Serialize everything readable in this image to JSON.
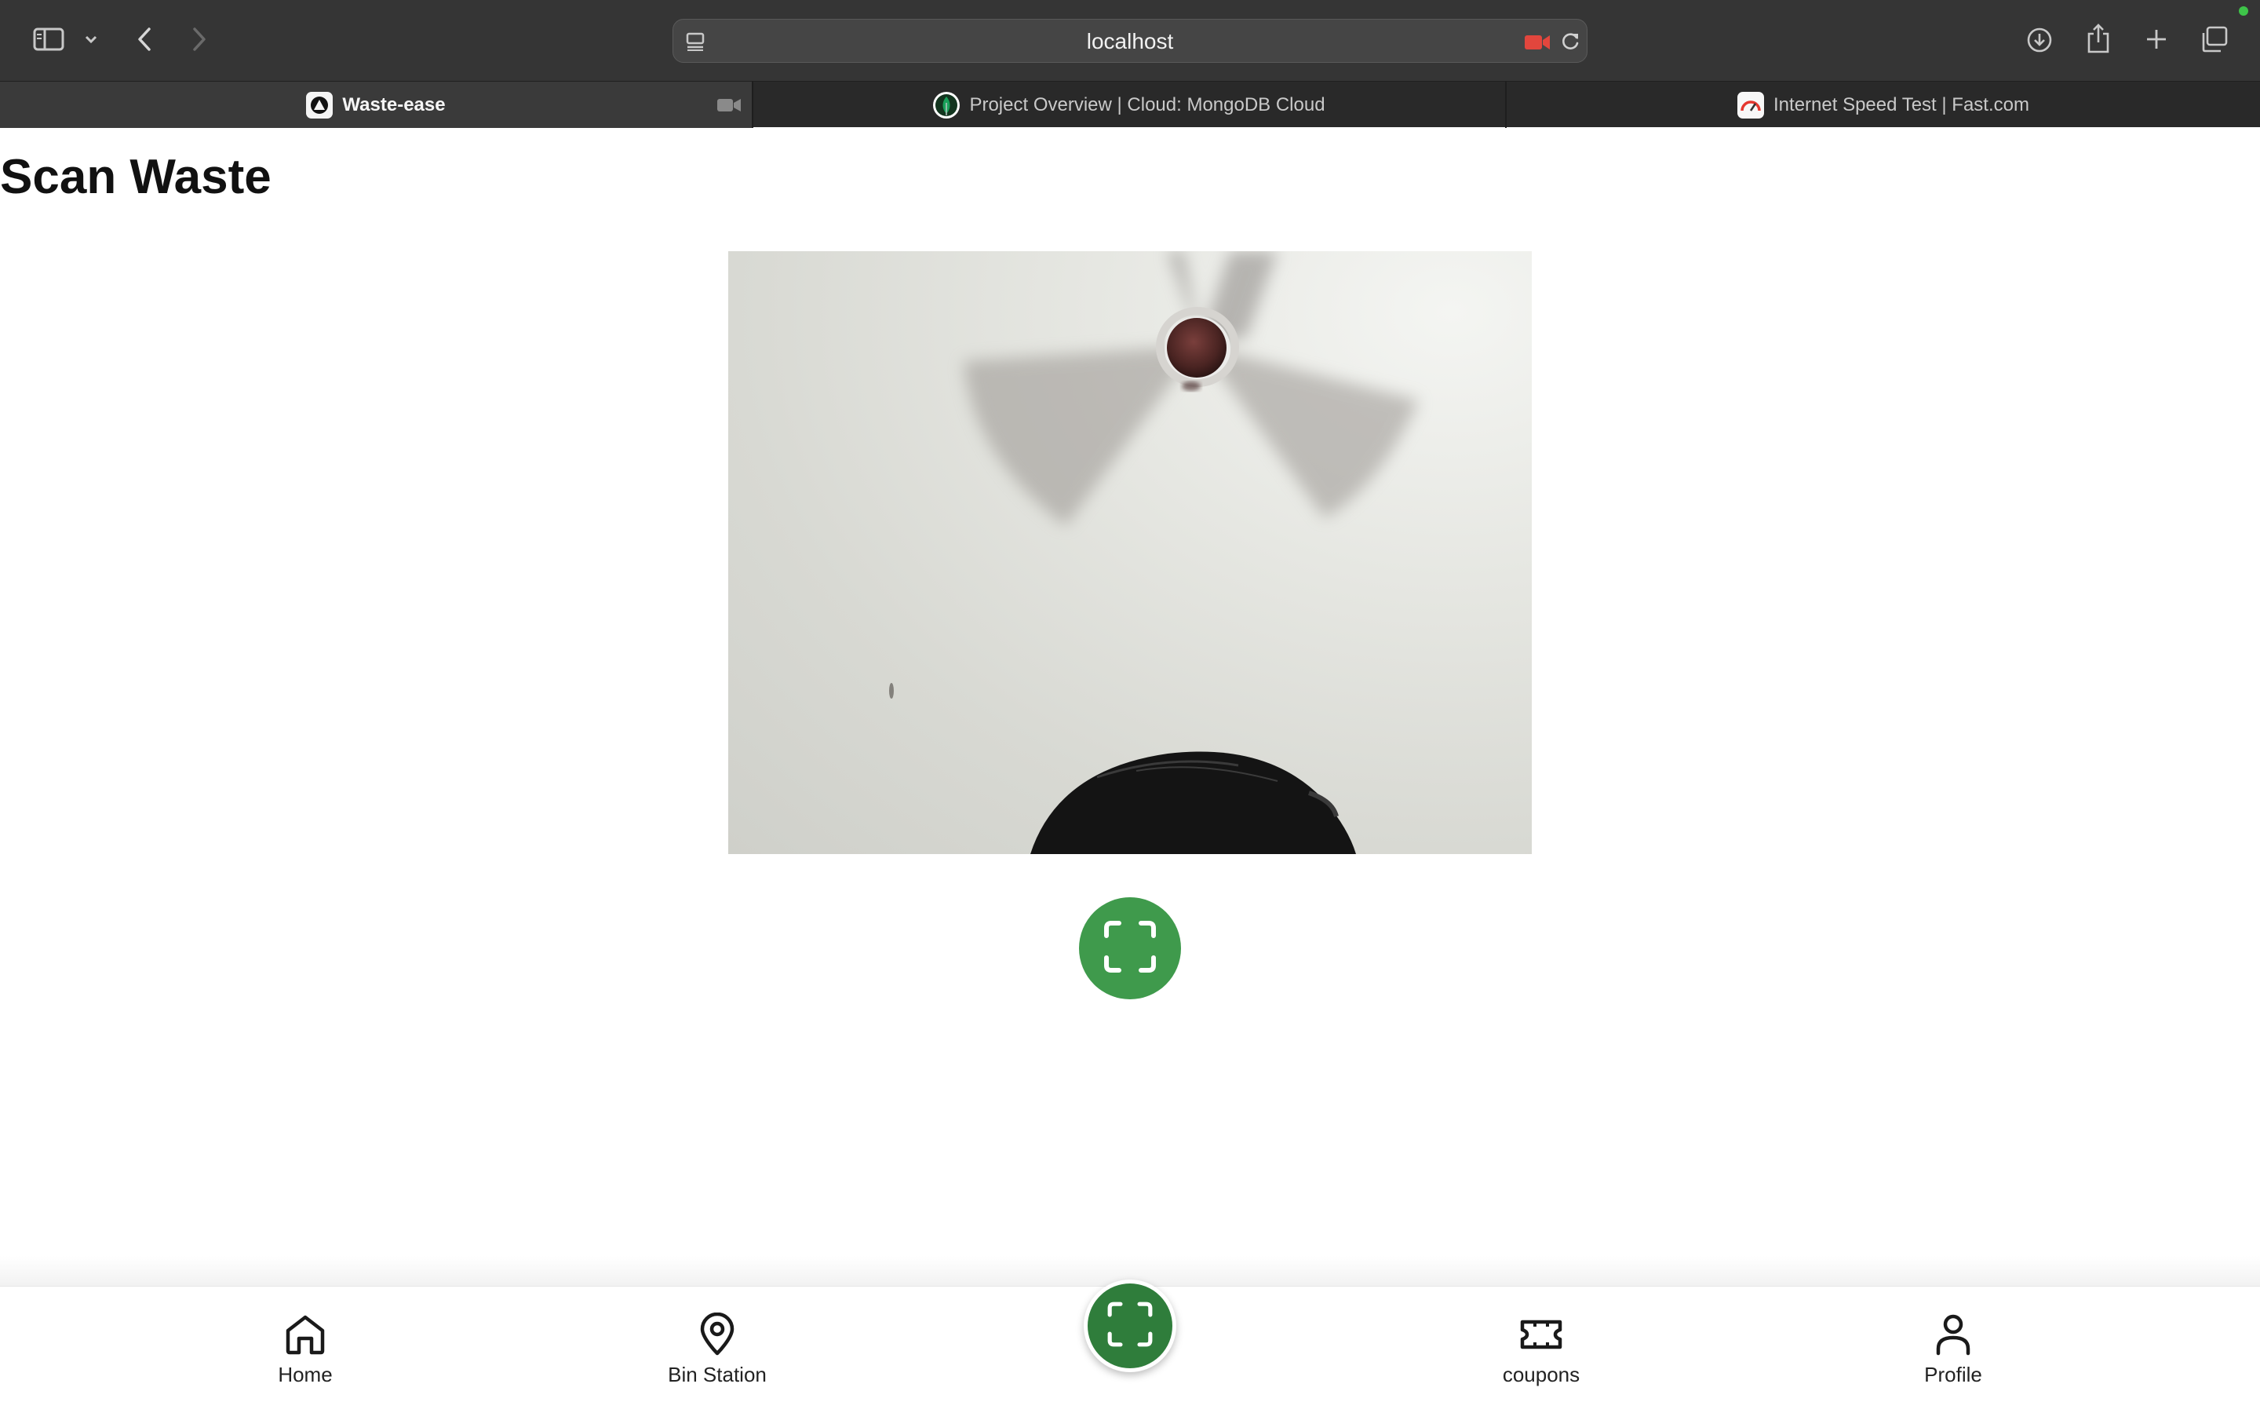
{
  "browser": {
    "url": "localhost",
    "tabs": [
      {
        "title": "Waste-ease",
        "active": true,
        "icon": "app-logo-icon"
      },
      {
        "title": "Project Overview | Cloud: MongoDB Cloud",
        "active": false,
        "icon": "mongodb-leaf-icon"
      },
      {
        "title": "Internet Speed Test | Fast.com",
        "active": false,
        "icon": "fast-speedometer-icon"
      }
    ],
    "colors": {
      "recording": "#e2463d",
      "status_dot": "#3ec449"
    }
  },
  "page": {
    "title": "Scan Waste",
    "camera_feed": "live-camera-view",
    "scan_button_icon": "scan-frame-icon",
    "accent": "#3f9a4c"
  },
  "bottom_nav": {
    "items": [
      {
        "label": "Home",
        "icon": "home-icon"
      },
      {
        "label": "Bin Station",
        "icon": "map-pin-icon"
      },
      {
        "label": "coupons",
        "icon": "ticket-icon"
      },
      {
        "label": "Profile",
        "icon": "user-icon"
      }
    ],
    "center_icon": "scan-frame-icon",
    "center_color": "#2f7d3b"
  }
}
